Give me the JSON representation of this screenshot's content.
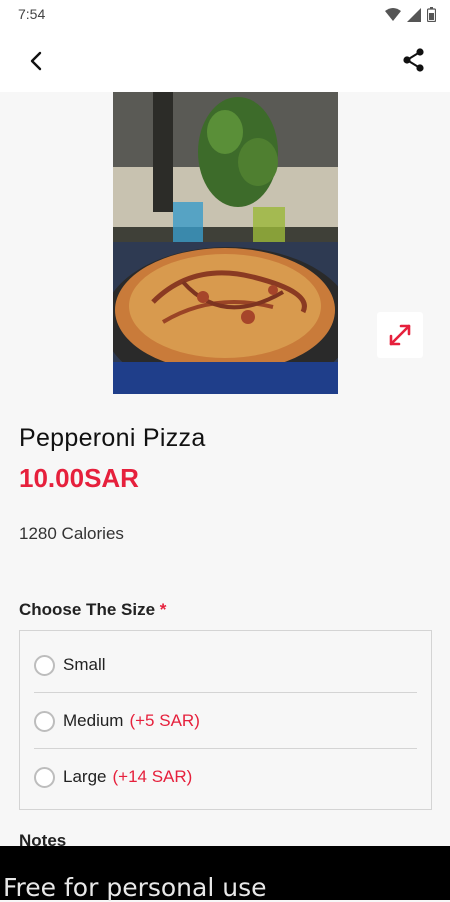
{
  "status_bar": {
    "time": "7:54"
  },
  "app_bar": {
    "back_icon": "back-arrow-icon",
    "share_icon": "share-icon"
  },
  "product": {
    "image_alt": "pizza-photo",
    "name": "Pepperoni Pizza",
    "price": "10.00SAR",
    "calories": "1280 Calories"
  },
  "size_section": {
    "heading": "Choose The Size",
    "required_mark": "*",
    "options": [
      {
        "label": "Small",
        "extra": ""
      },
      {
        "label": "Medium",
        "extra": "(+5 SAR)"
      },
      {
        "label": "Large",
        "extra": "(+14 SAR)"
      }
    ]
  },
  "notes_heading": "Notes",
  "watermark": "Free for personal use",
  "colors": {
    "accent": "#e6203c",
    "background": "#f7f7f7"
  }
}
